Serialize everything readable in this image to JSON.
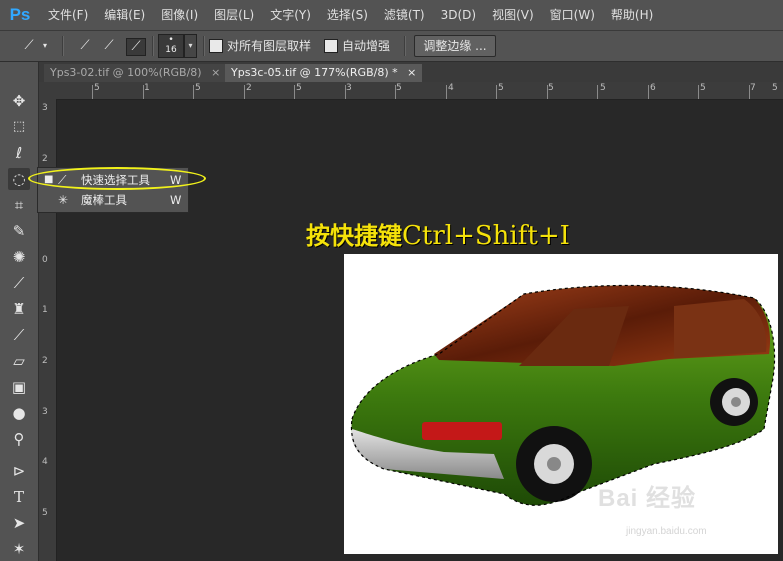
{
  "app": {
    "logo": "Ps"
  },
  "menu": [
    "文件(F)",
    "编辑(E)",
    "图像(I)",
    "图层(L)",
    "文字(Y)",
    "选择(S)",
    "滤镜(T)",
    "3D(D)",
    "视图(V)",
    "窗口(W)",
    "帮助(H)"
  ],
  "options": {
    "brush_size": "16",
    "sample_all_layers": "对所有图层取样",
    "auto_enhance": "自动增强",
    "refine_edge": "调整边缘 ..."
  },
  "tabs": [
    {
      "label": "Yps3-02.tif @ 100%(RGB/8)",
      "close": "×",
      "active": false
    },
    {
      "label": "Yps3c-05.tif @ 177%(RGB/8) *",
      "close": "×",
      "active": true
    }
  ],
  "ruler_h_labels": [
    "5",
    "1",
    "5",
    "2",
    "5",
    "3",
    "5",
    "4",
    "5",
    "5",
    "5",
    "6",
    "5",
    "7",
    "5"
  ],
  "ruler_v_labels": [
    "3",
    "2",
    "1",
    "0",
    "1",
    "2",
    "3",
    "4",
    "5"
  ],
  "flyout": [
    {
      "label": "快速选择工具",
      "shortcut": "W",
      "current": true,
      "icon": "quick-selection-icon"
    },
    {
      "label": "魔棒工具",
      "shortcut": "W",
      "current": false,
      "icon": "magic-wand-icon"
    }
  ],
  "caption": {
    "cjk": "按快捷键",
    "keys": "Ctrl+Shift+I"
  },
  "watermark": {
    "logo": "Bai 经验",
    "url": "jingyan.baidu.com"
  },
  "colors": {
    "accent": "#31a8ff",
    "highlight": "#f2f21a",
    "caption": "#f5e20a"
  }
}
